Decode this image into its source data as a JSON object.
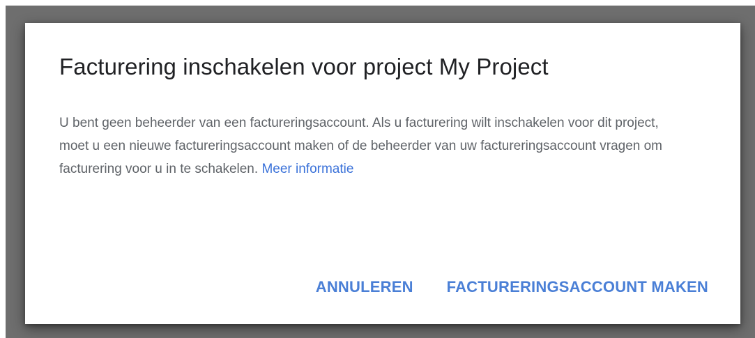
{
  "dialog": {
    "title": "Facturering inschakelen voor project My Project",
    "body": "U bent geen beheerder van een factureringsaccount. Als u facturering wilt inschakelen voor dit project, moet u een nieuwe factureringsaccount maken of de beheerder van uw factureringsaccount vragen om facturering voor u in te schakelen.",
    "link_label": "Meer informatie",
    "cancel_label": "ANNULEREN",
    "confirm_label": "FACTURERINGSACCOUNT MAKEN"
  },
  "colors": {
    "accent": "#4a7fd6",
    "link": "#3b72d9",
    "body_text": "#5f6368",
    "title_text": "#202124",
    "backdrop": "#6e6e6e"
  }
}
